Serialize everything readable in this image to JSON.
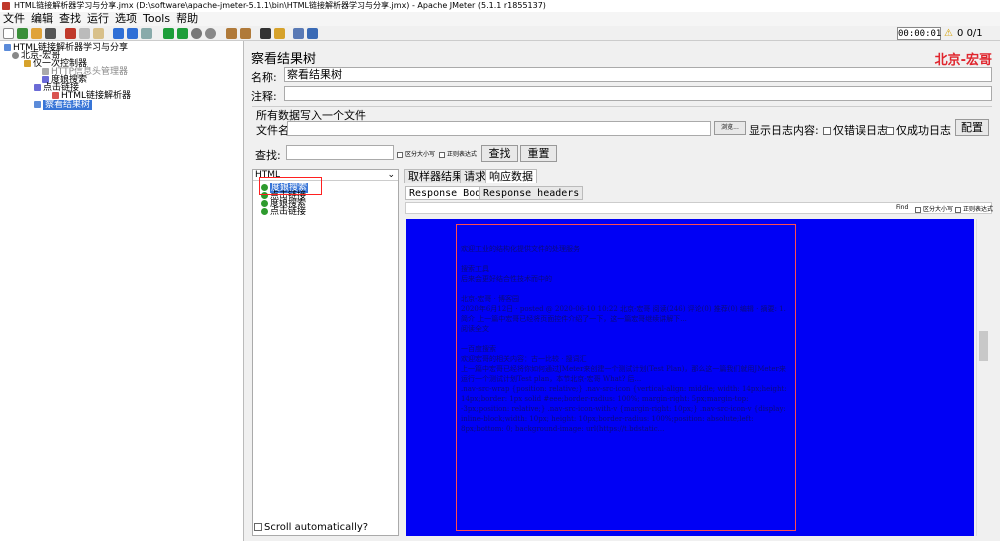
{
  "window": {
    "title": "HTML链接解析器学习与分享.jmx (D:\\software\\apache-jmeter-5.1.1\\bin\\HTML链接解析器学习与分享.jmx) - Apache JMeter (5.1.1 r1855137)"
  },
  "menu": [
    "文件",
    "编辑",
    "查找",
    "运行",
    "选项",
    "Tools",
    "帮助"
  ],
  "toolbar": {
    "timer": "00:00:01",
    "warnings": "0",
    "threads": "0/1"
  },
  "tree": {
    "root": "HTML链接解析器学习与分享",
    "group": "北京-宏哥",
    "controller": "仅一次控制器",
    "header_manager": "HTTP信息头管理器",
    "search1": "度娘搜索",
    "click_link": "点击链接",
    "parser": "HTML链接解析器",
    "listener": "察看结果树"
  },
  "panel": {
    "title": "察看结果树",
    "brand": "北京-宏哥",
    "name_label": "名称:",
    "name_value": "察看结果树",
    "comment_label": "注释:",
    "file_group": "所有数据写入一个文件",
    "file_label": "文件名",
    "browse_button": "浏览...",
    "log_label": "显示日志内容:",
    "error_only": "仅错误日志",
    "success_only": "仅成功日志",
    "config_button": "配置",
    "search_label": "查找:",
    "case_sensitive": "区分大小写",
    "regex": "正则表达式",
    "search_button": "查找",
    "reset_button": "重置"
  },
  "results": {
    "renderer": "HTML",
    "items": [
      "度娘搜索",
      "点击链接",
      "度娘搜索",
      "点击链接"
    ],
    "scroll_auto": "Scroll automatically?"
  },
  "detail": {
    "tabs": [
      "取样器结果",
      "请求",
      "响应数据"
    ],
    "subtabs": [
      "Response Body",
      "Response headers"
    ],
    "find_label": "Find",
    "find_case": "区分大小写",
    "find_regex": "正则表达式",
    "body_lines": [
      "欢迎工业的结构化提供文件的处理服务",
      "",
      "搜索工具",
      "后来会更好结合性技术而中的",
      "",
      "北京-宏哥 · 博客园",
      "2020年6月12日 · posted @ 2020-06-10 10:22 北京-宏哥 阅读(246) 评论(0) 推荐(0) 编辑 · 摘要: 1.简介 上一篇中宏哥已经将页面控件介绍了一下，这一篇宏哥继续讲解下...",
      "阅读全文",
      "",
      "一百度搜索",
      "欢迎宏哥的相关内容：古一比较 · 搜词汇",
      "上一篇中宏哥已经将你如何通过JMeter来创建一个测试计划(Test Plan)，那么这一篇我们就用JMeter来运行一个测试计划Test plan，本节北京-宏哥 What? 后...",
      ".nav-src-wrap {position: relative;} .nav-src-icon {vertical-align: middle; width: 14px;height: 14px;border: 1px solid #eee;border-radius: 100%; margin-right: 5px;margin-top: -3px;position: relative;} .nav-src-icon-with-v {margin-right: 10px;} .nav-src-icon-v {display: inline-block;width: 10px; height: 10px;border-radius: 100%;position: absolute;left: 8px;bottom: 0; background-image: url(https://t.bdstatic..."
    ]
  }
}
